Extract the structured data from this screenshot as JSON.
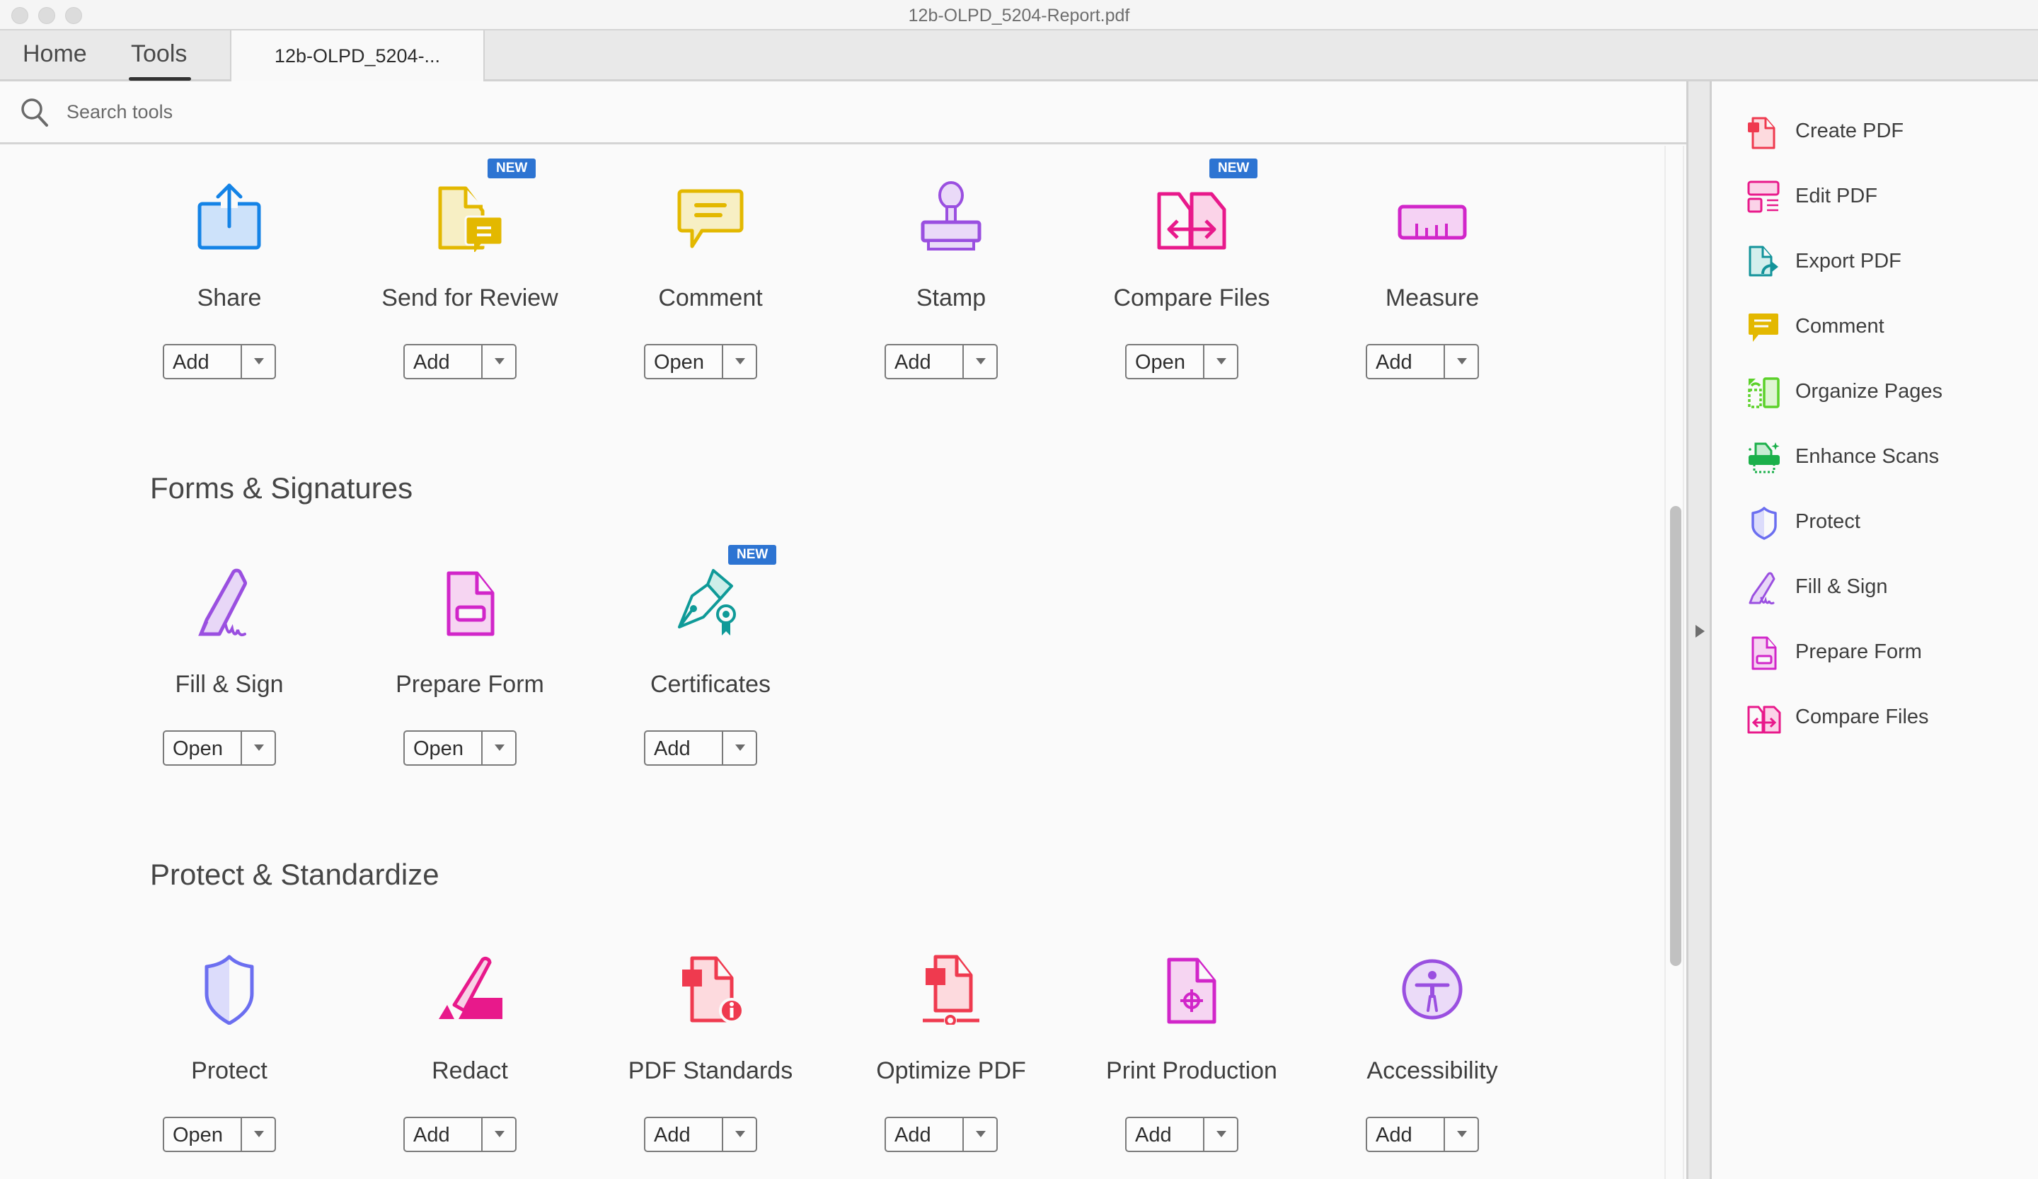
{
  "window": {
    "title": "12b-OLPD_5204-Report.pdf"
  },
  "tabs": {
    "home": "Home",
    "tools": "Tools",
    "document": "12b-OLPD_5204-..."
  },
  "search": {
    "placeholder": "Search tools"
  },
  "badge_text": "NEW",
  "top_row": [
    {
      "label": "Share",
      "button": "Add",
      "icon": "share-icon",
      "new": false
    },
    {
      "label": "Send for Review",
      "button": "Add",
      "icon": "send-for-review-icon",
      "new": true
    },
    {
      "label": "Comment",
      "button": "Open",
      "icon": "comment-icon",
      "new": false
    },
    {
      "label": "Stamp",
      "button": "Add",
      "icon": "stamp-icon",
      "new": false
    },
    {
      "label": "Compare Files",
      "button": "Open",
      "icon": "compare-files-icon",
      "new": true
    },
    {
      "label": "Measure",
      "button": "Add",
      "icon": "measure-icon",
      "new": false
    }
  ],
  "sections": [
    {
      "title": "Forms & Signatures",
      "tools": [
        {
          "label": "Fill & Sign",
          "button": "Open",
          "icon": "fill-sign-icon",
          "new": false
        },
        {
          "label": "Prepare Form",
          "button": "Open",
          "icon": "prepare-form-icon",
          "new": false
        },
        {
          "label": "Certificates",
          "button": "Add",
          "icon": "certificates-icon",
          "new": true
        }
      ]
    },
    {
      "title": "Protect & Standardize",
      "tools": [
        {
          "label": "Protect",
          "button": "Open",
          "icon": "protect-icon",
          "new": false
        },
        {
          "label": "Redact",
          "button": "Add",
          "icon": "redact-icon",
          "new": false
        },
        {
          "label": "PDF Standards",
          "button": "Add",
          "icon": "pdf-standards-icon",
          "new": false
        },
        {
          "label": "Optimize PDF",
          "button": "Add",
          "icon": "optimize-pdf-icon",
          "new": false
        },
        {
          "label": "Print Production",
          "button": "Add",
          "icon": "print-production-icon",
          "new": false
        },
        {
          "label": "Accessibility",
          "button": "Add",
          "icon": "accessibility-icon",
          "new": false
        }
      ]
    }
  ],
  "right_panel": [
    {
      "label": "Create PDF",
      "icon": "create-pdf-icon"
    },
    {
      "label": "Edit PDF",
      "icon": "edit-pdf-icon"
    },
    {
      "label": "Export PDF",
      "icon": "export-pdf-icon"
    },
    {
      "label": "Comment",
      "icon": "comment-icon"
    },
    {
      "label": "Organize Pages",
      "icon": "organize-pages-icon"
    },
    {
      "label": "Enhance Scans",
      "icon": "enhance-scans-icon"
    },
    {
      "label": "Protect",
      "icon": "protect-icon"
    },
    {
      "label": "Fill & Sign",
      "icon": "fill-sign-icon"
    },
    {
      "label": "Prepare Form",
      "icon": "prepare-form-icon"
    },
    {
      "label": "Compare Files",
      "icon": "compare-files-icon"
    }
  ],
  "colors": {
    "badge": "#2d74d2",
    "share": "#1483e6",
    "review": "#e3b800",
    "stamp": "#9a4fe0",
    "compare": "#e8198b",
    "measure": "#d126c9",
    "protect": "#6b6ef0",
    "create": "#ef3a4f",
    "export": "#13939a",
    "organize": "#5cd12a",
    "enhance": "#1bb04a",
    "certificates": "#0f9a98"
  }
}
